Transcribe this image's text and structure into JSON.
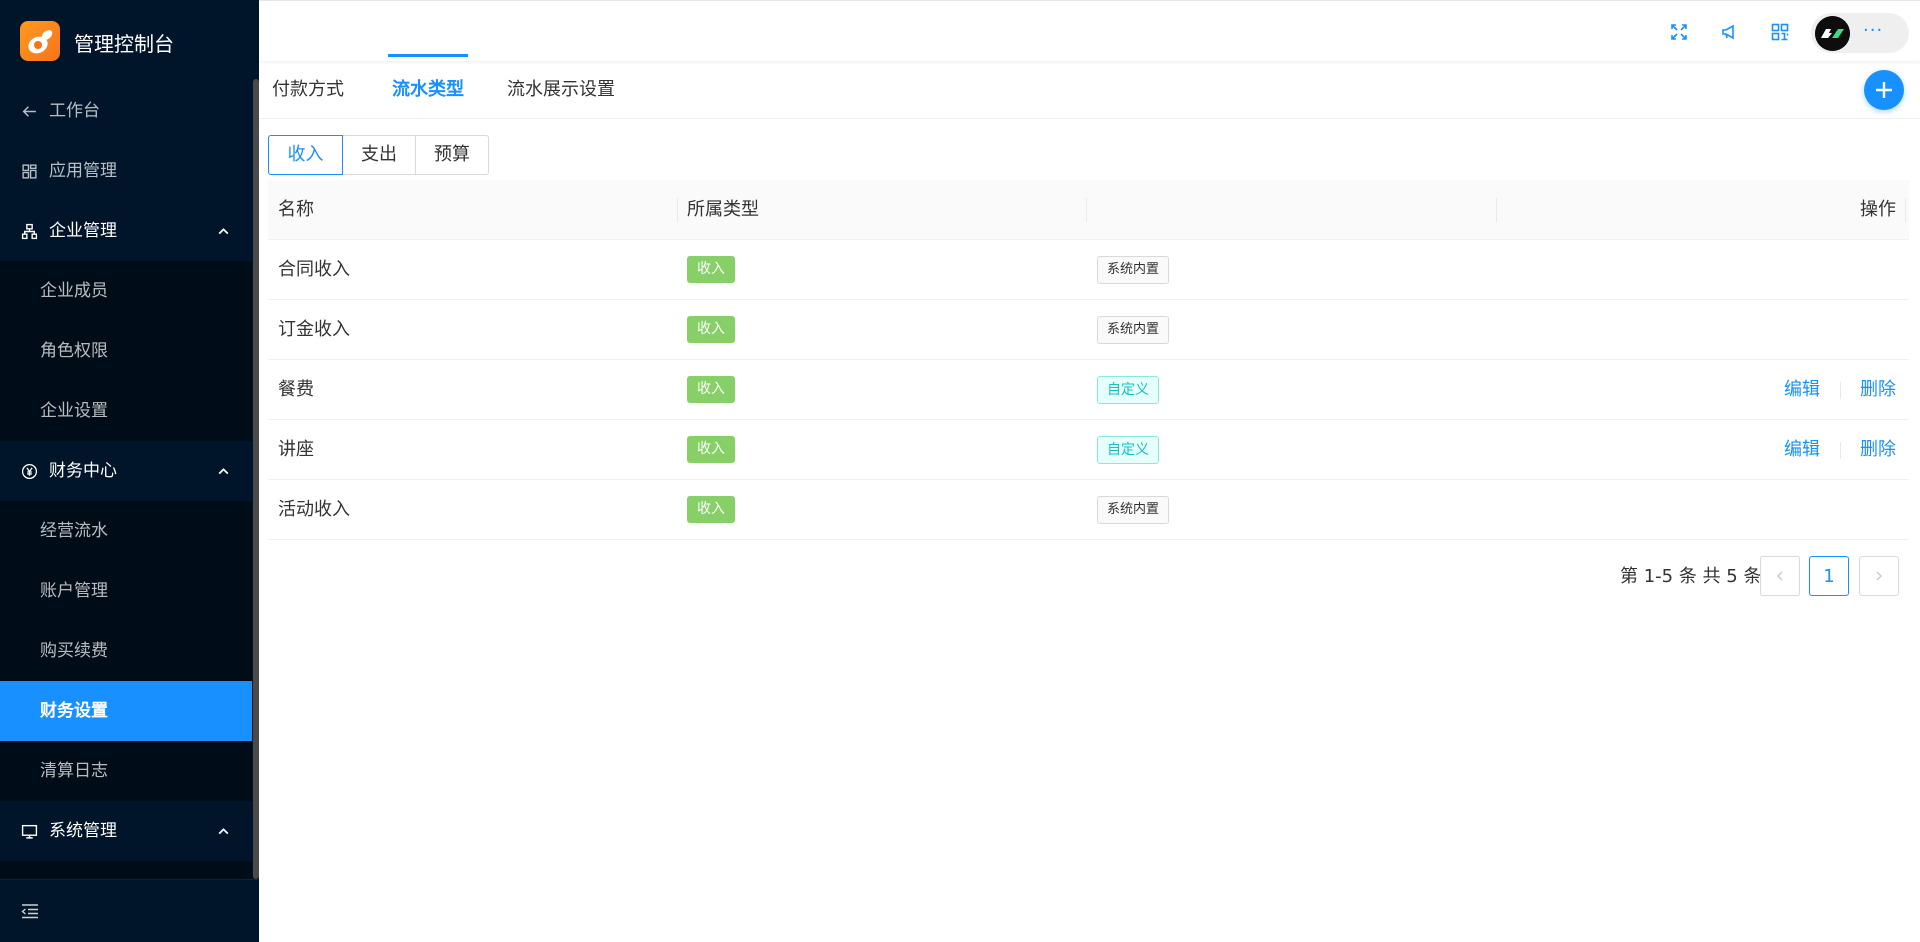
{
  "app": {
    "title": "管理控制台"
  },
  "sidebar": {
    "items": [
      {
        "label": "工作台",
        "icon": "arrow-left-icon"
      },
      {
        "label": "应用管理",
        "icon": "apps-icon"
      },
      {
        "label": "企业管理",
        "icon": "org-chart-icon",
        "expanded": true
      },
      {
        "label": "企业成员"
      },
      {
        "label": "角色权限"
      },
      {
        "label": "企业设置"
      },
      {
        "label": "财务中心",
        "icon": "yen-icon",
        "expanded": true
      },
      {
        "label": "经营流水"
      },
      {
        "label": "账户管理"
      },
      {
        "label": "购买续费"
      },
      {
        "label": "财务设置",
        "active": true
      },
      {
        "label": "清算日志"
      },
      {
        "label": "系统管理",
        "icon": "monitor-icon",
        "expanded": true
      }
    ]
  },
  "header": {
    "icons": [
      "fullscreen-icon",
      "notification-icon",
      "qrcode-icon"
    ],
    "user_more": "···"
  },
  "tabs": [
    {
      "label": "付款方式"
    },
    {
      "label": "流水类型",
      "active": true
    },
    {
      "label": "流水展示设置"
    }
  ],
  "segment": [
    {
      "label": "收入",
      "active": true
    },
    {
      "label": "支出"
    },
    {
      "label": "预算"
    }
  ],
  "table": {
    "columns": [
      "名称",
      "所属类型",
      "",
      "操作"
    ],
    "rows": [
      {
        "name": "合同收入",
        "type": "收入",
        "source": "系统内置"
      },
      {
        "name": "订金收入",
        "type": "收入",
        "source": "系统内置"
      },
      {
        "name": "餐费",
        "type": "收入",
        "source": "自定义",
        "edit": "编辑",
        "delete": "删除"
      },
      {
        "name": "讲座",
        "type": "收入",
        "source": "自定义",
        "edit": "编辑",
        "delete": "删除"
      },
      {
        "name": "活动收入",
        "type": "收入",
        "source": "系统内置"
      }
    ]
  },
  "pagination": {
    "total_text": "第 1-5 条 共 5 条",
    "current_page": "1"
  },
  "colors": {
    "primary": "#1890ff",
    "sidebar_bg": "#001529",
    "tag_green": "#87d068",
    "tag_cyan": "#13c2c2"
  }
}
